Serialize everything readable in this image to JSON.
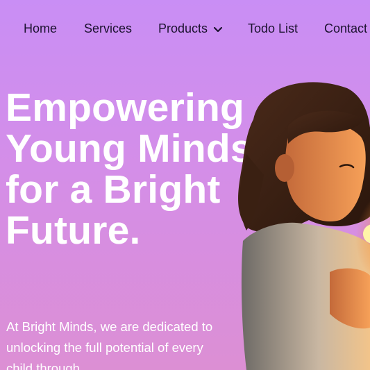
{
  "nav": {
    "items": [
      {
        "label": "Home"
      },
      {
        "label": "Services"
      },
      {
        "label": "Products"
      },
      {
        "label": "Todo List"
      },
      {
        "label": "Contact"
      }
    ],
    "products_icon": "chevron-down-icon"
  },
  "hero": {
    "title": "Empowering Young Minds for a Bright Future.",
    "description": "At Bright Minds, we are dedicated to unlocking the full potential of every child through",
    "image": "child-with-glowing-light-photo"
  },
  "colors": {
    "background_top": "#c98ef5",
    "background_bottom": "#dc8fd4",
    "nav_text": "#1c1230",
    "hero_text": "#ffffff"
  }
}
